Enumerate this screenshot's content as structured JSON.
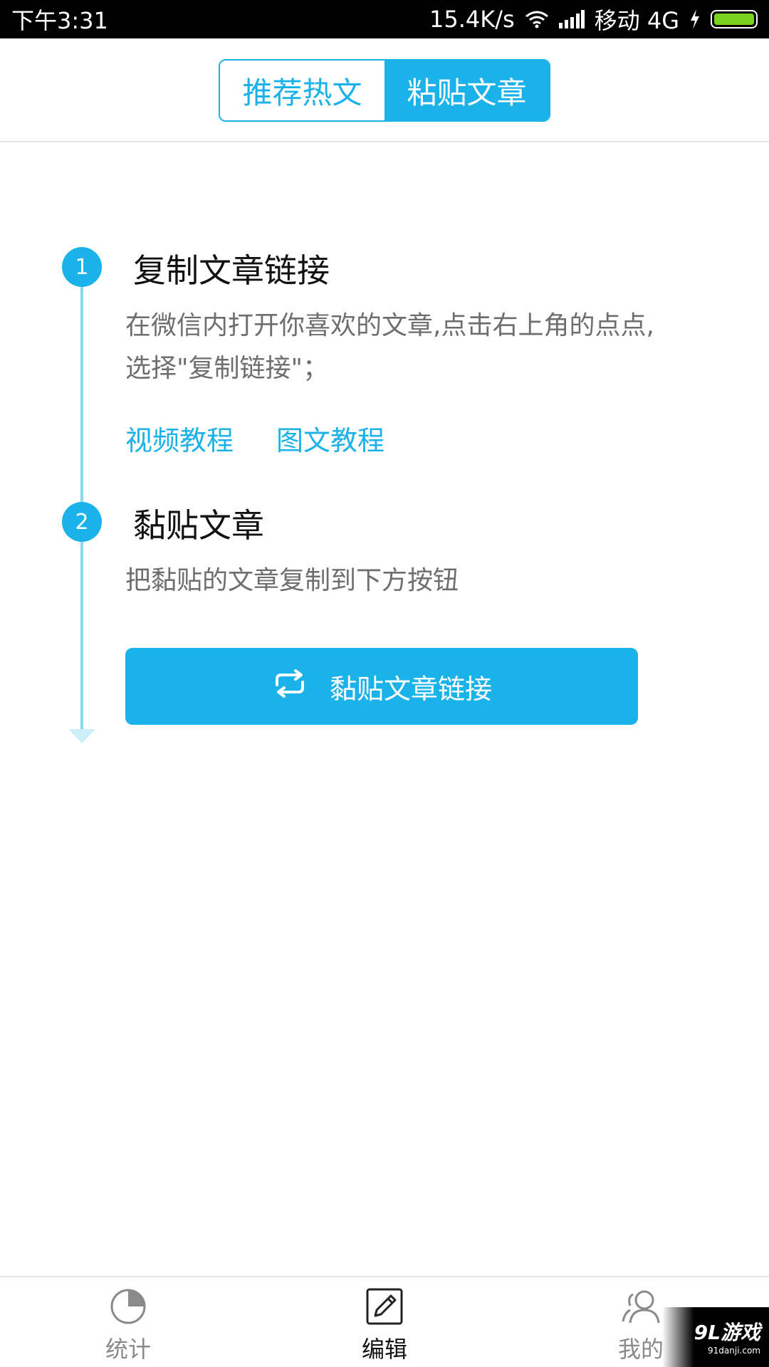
{
  "status_bar": {
    "time": "下午3:31",
    "network_speed": "15.4K/s",
    "carrier": "移动 4G"
  },
  "tabs": [
    {
      "label": "推荐热文",
      "active": false
    },
    {
      "label": "粘贴文章",
      "active": true
    }
  ],
  "steps": [
    {
      "number": "1",
      "title": "复制文章链接",
      "desc_line1": "在微信内打开你喜欢的文章,点击右上角的点点,",
      "desc_line2": "选择\"复制链接\"；",
      "links": [
        "视频教程",
        "图文教程"
      ]
    },
    {
      "number": "2",
      "title": "黏贴文章",
      "desc_line1": "把黏贴的文章复制到下方按钮"
    }
  ],
  "paste_button": {
    "label": "黏贴文章链接",
    "icon": "refresh-icon"
  },
  "bottom_nav": [
    {
      "label": "统计",
      "icon": "pie-chart-icon",
      "active": false
    },
    {
      "label": "编辑",
      "icon": "edit-icon",
      "active": true
    },
    {
      "label": "我的",
      "icon": "user-icon",
      "active": false
    }
  ],
  "watermark": {
    "main": "9L游戏",
    "sub": "91danji.com"
  },
  "colors": {
    "accent": "#1bb1e9",
    "timeline": "#8fd6f4"
  }
}
